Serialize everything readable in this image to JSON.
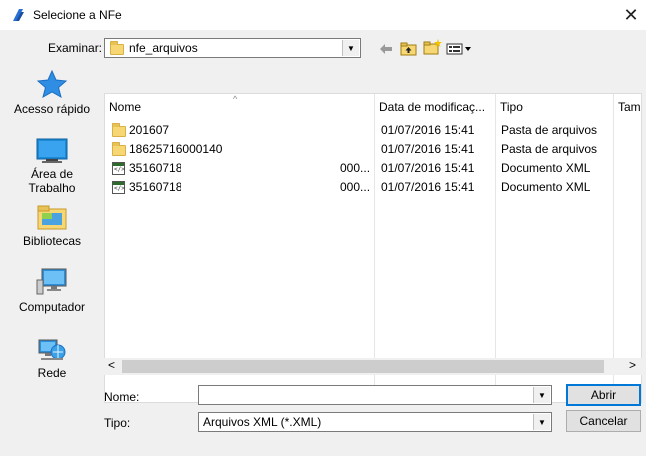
{
  "window": {
    "title": "Selecione a NFe",
    "close_symbol": "✕"
  },
  "lookin": {
    "label": "Examinar:",
    "value": "nfe_arquivos"
  },
  "toolbar": {
    "back_icon": "back-arrow-icon",
    "up_icon": "up-folder-icon",
    "new_folder_icon": "new-folder-icon",
    "view_icon": "view-menu-icon"
  },
  "places": [
    {
      "label": "Acesso rápido",
      "icon": "quick-access-star-icon"
    },
    {
      "label": "Área de Trabalho",
      "icon": "desktop-icon"
    },
    {
      "label": "Bibliotecas",
      "icon": "libraries-icon"
    },
    {
      "label": "Computador",
      "icon": "computer-icon"
    },
    {
      "label": "Rede",
      "icon": "network-icon"
    }
  ],
  "columns": [
    "Nome",
    "Data de modificaç...",
    "Tipo",
    "Tam"
  ],
  "files": [
    {
      "name": "201607",
      "extra": "",
      "date": "01/07/2016 15:41",
      "type": "Pasta de arquivos",
      "icon": "folder-icon"
    },
    {
      "name": "18625716000140",
      "extra": "",
      "date": "01/07/2016 15:41",
      "type": "Pasta de arquivos",
      "icon": "folder-icon"
    },
    {
      "name": "35160718",
      "extra": "000...",
      "date": "01/07/2016 15:41",
      "type": "Documento XML",
      "icon": "xml-file-icon"
    },
    {
      "name": "35160718",
      "extra": "000...",
      "date": "01/07/2016 15:41",
      "type": "Documento XML",
      "icon": "xml-file-icon"
    }
  ],
  "filename": {
    "label": "Nome:",
    "value": ""
  },
  "filetype": {
    "label": "Tipo:",
    "value": "Arquivos XML (*.XML)"
  },
  "buttons": {
    "open": "Abrir",
    "cancel": "Cancelar"
  },
  "scroll": {
    "left": "<",
    "right": ">"
  }
}
